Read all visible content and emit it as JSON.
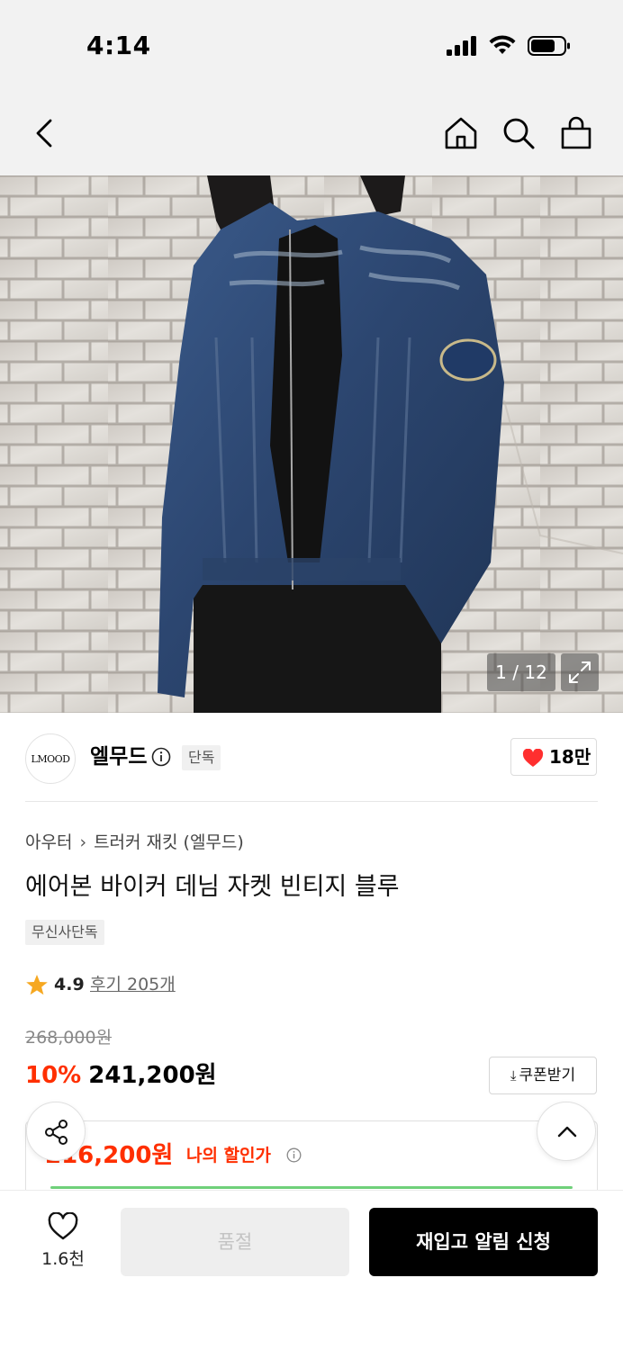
{
  "status_bar": {
    "time": "4:14"
  },
  "nav": {
    "icons": [
      "back-icon",
      "home-icon",
      "search-icon",
      "shopping-bag-icon"
    ]
  },
  "gallery": {
    "counter": "1 / 12",
    "expand_icon": "expand-icon"
  },
  "brand": {
    "logo_text": "LMOOD",
    "name": "엘무드",
    "exclusive_tag": "단독",
    "like_count": "18만",
    "like_color": "#ff2f2f"
  },
  "product": {
    "breadcrumb": [
      "아우터",
      "트러커 재킷 (엘무드)"
    ],
    "breadcrumb_sep": "›",
    "title": "에어본 바이커 데님 자켓 빈티지 블루",
    "exclusive_badge": "무신사단독",
    "rating": "4.9",
    "reviews": "후기 205개",
    "original_price": "268,000원",
    "discount": "10%",
    "sale_price": "241,200원",
    "coupon_label": "쿠폰받기"
  },
  "my_discount": {
    "price": "216,200원",
    "label": "나의 할인가"
  },
  "bottom": {
    "wish_count": "1.6천",
    "soldout_label": "품절",
    "restock_label": "재입고 알림 신청"
  },
  "colors": {
    "accent": "#ff2f00",
    "primary_button": "#000000"
  }
}
